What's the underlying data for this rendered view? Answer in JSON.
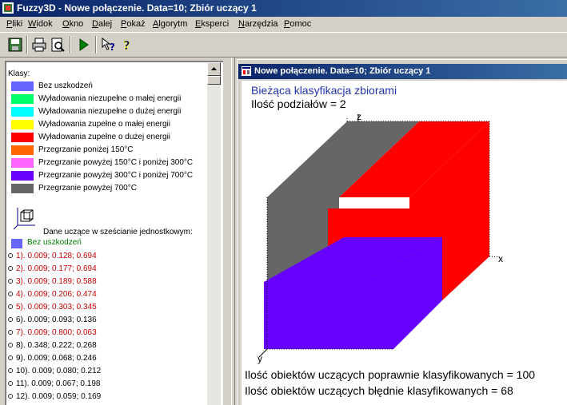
{
  "app": {
    "title": "Fuzzy3D - Nowe połączenie.  Data=10; Zbiór uczący 1"
  },
  "menu": {
    "items": [
      "Pliki",
      "Widok",
      "Okno",
      "Dalej",
      "Pokaż",
      "Algorytm",
      "Eksperci",
      "Narzędzia",
      "Pomoc"
    ]
  },
  "toolbar": {
    "icons": [
      "save-icon",
      "print-icon",
      "print-preview-icon",
      "run-icon",
      "help-context-icon",
      "help-icon"
    ]
  },
  "panel": {
    "header": "Klasy:",
    "classes": [
      {
        "label": "Bez uszkodzeń",
        "color": "#6666ff"
      },
      {
        "label": "Wyładowania niezupełne o małej energii",
        "color": "#00ff66"
      },
      {
        "label": "Wyładowania niezupełne o dużej energii",
        "color": "#00ffff"
      },
      {
        "label": "Wyładowania zupełne o małej energii",
        "color": "#ffff00"
      },
      {
        "label": "Wyładowania zupełne o dużej energii",
        "color": "#ff0000"
      },
      {
        "label": "Przegrzanie poniżej 150°C",
        "color": "#ff6600"
      },
      {
        "label": "Przegrzanie powyżej 150°C i poniżej 300°C",
        "color": "#ff66ff"
      },
      {
        "label": "Przegrzanie powyżej 300°C i poniżej 700°C",
        "color": "#6600ff"
      },
      {
        "label": "Przegrzanie powyżej 700°C",
        "color": "#666666"
      }
    ],
    "training_header": "Dane uczące w sześcianie jednostkowym:",
    "training_class": "Bez uszkodzeń",
    "items": [
      {
        "label": "1).  0.009; 0.128; 0.694",
        "color": "#cc0000"
      },
      {
        "label": "2).  0.009; 0.177; 0.694",
        "color": "#cc0000"
      },
      {
        "label": "3).  0.009; 0.189; 0.588",
        "color": "#cc0000"
      },
      {
        "label": "4).  0.009; 0.206; 0.474",
        "color": "#cc0000"
      },
      {
        "label": "5).  0.009; 0.303; 0.345",
        "color": "#cc0000"
      },
      {
        "label": "6).  0.009; 0.093; 0.136",
        "color": "#000000"
      },
      {
        "label": "7).  0.009; 0.800; 0.063",
        "color": "#cc0000"
      },
      {
        "label": "8).  0.348; 0.222; 0.268",
        "color": "#000000"
      },
      {
        "label": "9).  0.009; 0.068; 0.246",
        "color": "#000000"
      },
      {
        "label": "10).  0.009; 0.080; 0.212",
        "color": "#000000"
      },
      {
        "label": "11).  0.009; 0.067; 0.198",
        "color": "#000000"
      },
      {
        "label": "12).  0.009; 0.059; 0.169",
        "color": "#000000"
      }
    ]
  },
  "mdi": {
    "title": "Nowe połączenie.  Data=10; Zbiór uczący 1"
  },
  "canvas": {
    "title": "Bieżąca klasyfikacja zbiorami",
    "subtitle": "Ilość podziałów = 2",
    "axis_z": "z",
    "axis_x": "x",
    "axis_y": "y",
    "correct": "Ilość obiektów uczących poprawnie klasyfikowanych = 100",
    "wrong": "Ilość obiektów uczących błędnie klasyfikowanych = 68",
    "colors": {
      "gray": "#666666",
      "red": "#ff0000",
      "violet": "#6600ff"
    }
  }
}
